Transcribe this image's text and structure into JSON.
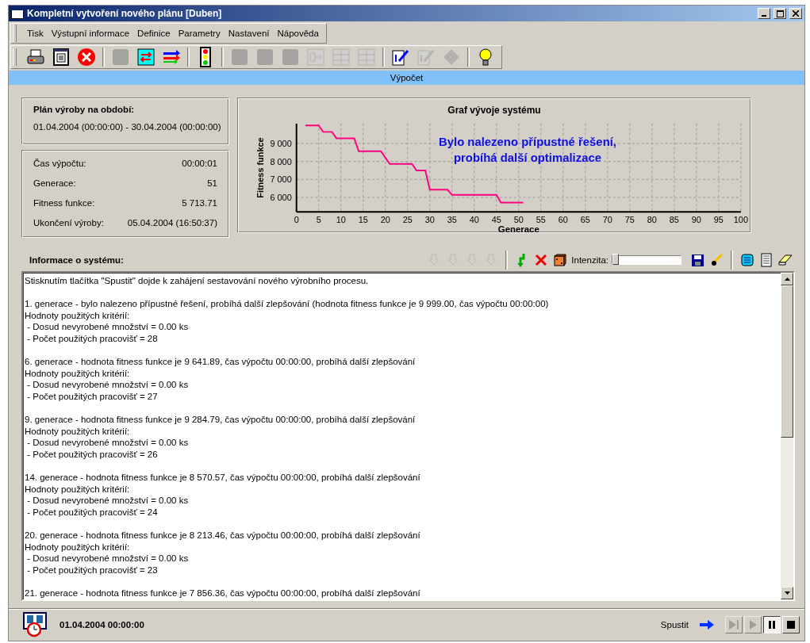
{
  "window": {
    "title": "Kompletní vytvoření nového plánu [Duben]"
  },
  "menu": [
    {
      "label": "Tisk"
    },
    {
      "label": "Výstupní informace"
    },
    {
      "label": "Definice"
    },
    {
      "label": "Parametry"
    },
    {
      "label": "Nastavení"
    },
    {
      "label": "Nápověda"
    }
  ],
  "toolbar": [
    [
      {
        "kind": "printer",
        "disabled": false
      },
      {
        "kind": "document",
        "disabled": false
      },
      {
        "kind": "cancel",
        "disabled": false
      }
    ],
    [
      {
        "kind": "blank",
        "disabled": true
      },
      {
        "kind": "swap",
        "disabled": false
      },
      {
        "kind": "arrows",
        "disabled": false
      }
    ],
    [
      {
        "kind": "traffic",
        "disabled": false
      }
    ],
    [
      {
        "kind": "blank",
        "disabled": true
      },
      {
        "kind": "blank",
        "disabled": true
      },
      {
        "kind": "blank",
        "disabled": true
      },
      {
        "kind": "flow",
        "disabled": true
      },
      {
        "kind": "grid",
        "disabled": true
      },
      {
        "kind": "grid",
        "disabled": true
      }
    ],
    [
      {
        "kind": "edit",
        "disabled": false
      },
      {
        "kind": "edit",
        "disabled": true
      },
      {
        "kind": "diamond",
        "disabled": true
      }
    ],
    [
      {
        "kind": "bulb",
        "disabled": false
      }
    ]
  ],
  "section_bar": "Výpočet",
  "plan": {
    "heading": "Plán výroby na období:",
    "range": "01.04.2004 (00:00:00) - 30.04.2004 (00:00:00)"
  },
  "stats": [
    {
      "label": "Čas výpočtu:",
      "value": "00:00:01"
    },
    {
      "label": "Generace:",
      "value": "51"
    },
    {
      "label": "Fitness funkce:",
      "value": "5 713.71"
    },
    {
      "label": "Ukončení výroby:",
      "value": "05.04.2004 (16:50:37)"
    }
  ],
  "chart": {
    "message": [
      "Bylo nalezeno přípustné řešení,",
      "probíhá další optimalizace"
    ],
    "chart_data": {
      "type": "line",
      "title": "Graf vývoje systému",
      "xlabel": "Generace",
      "ylabel": "Fitness funkce",
      "grid": true,
      "x": [
        2,
        3,
        4,
        5,
        6,
        7,
        8,
        9,
        10,
        11,
        12,
        13,
        14,
        15,
        16,
        17,
        18,
        19,
        20,
        21,
        22,
        23,
        24,
        25,
        26,
        27,
        28,
        29,
        30,
        31,
        32,
        33,
        34,
        35,
        36,
        37,
        38,
        39,
        40,
        41,
        42,
        43,
        44,
        45,
        46,
        47,
        48,
        49,
        50,
        51
      ],
      "series": [
        {
          "color": "#ff0080",
          "values": [
            10000,
            10000,
            10000,
            10000,
            9640,
            9640,
            9640,
            9280,
            9280,
            9280,
            9280,
            9280,
            8570,
            8570,
            8570,
            8570,
            8570,
            8570,
            8210,
            7860,
            7860,
            7860,
            7860,
            7860,
            7860,
            7500,
            7500,
            7500,
            6430,
            6430,
            6430,
            6430,
            6430,
            6140,
            6140,
            6140,
            6140,
            6140,
            6140,
            6140,
            6140,
            6140,
            6140,
            6140,
            5710,
            5710,
            5710,
            5710,
            5710,
            5710
          ]
        }
      ],
      "xlim": [
        0,
        100
      ],
      "ylim": [
        5200,
        10100
      ],
      "xticks": [
        0,
        5,
        10,
        15,
        20,
        25,
        30,
        35,
        40,
        45,
        50,
        55,
        60,
        65,
        70,
        75,
        80,
        85,
        90,
        95,
        100
      ],
      "yticks": [
        {
          "value": 6000,
          "label": "6 000"
        },
        {
          "value": 7000,
          "label": "7 000"
        },
        {
          "value": 8000,
          "label": "8 000"
        },
        {
          "value": 9000,
          "label": "9 000"
        }
      ]
    }
  },
  "log": {
    "heading": "Informace o systému:",
    "tools": [
      [
        {
          "kind": "down",
          "disabled": true
        },
        {
          "kind": "down",
          "disabled": true
        },
        {
          "kind": "down",
          "disabled": true
        },
        {
          "kind": "down",
          "disabled": true
        }
      ],
      [
        {
          "kind": "green-arrow",
          "disabled": false
        },
        {
          "kind": "red-x",
          "disabled": false
        },
        {
          "kind": "dice",
          "disabled": false
        }
      ]
    ],
    "intensity": {
      "label": "Intenzita:",
      "level": 0.02
    },
    "tools2": [
      [
        {
          "kind": "save",
          "disabled": false
        },
        {
          "kind": "brush",
          "disabled": false
        }
      ],
      [
        {
          "kind": "note",
          "disabled": false
        },
        {
          "kind": "list",
          "disabled": false
        },
        {
          "kind": "eraser",
          "disabled": false
        }
      ]
    ],
    "entries": [
      {
        "lines": [
          "Stisknutím tlačítka \"Spustit\" dojde k zahájení sestavování nového výrobního procesu."
        ]
      },
      {
        "lines": [
          "1. generace - bylo nalezeno přípustné řešení, probíhá další zlepšování (hodnota fitness funkce je 9 999.00, čas výpočtu 00:00:00)",
          "Hodnoty použitých kritérií:",
          " - Dosud nevyrobené množství = 0.00 ks",
          " - Počet použitých pracovišť = 28"
        ]
      },
      {
        "lines": [
          "6. generace - hodnota fitness funkce je 9 641.89, čas výpočtu 00:00:00, probíhá další zlepšování",
          "Hodnoty použitých kritérií:",
          " - Dosud nevyrobené množství = 0.00 ks",
          " - Počet použitých pracovišť = 27"
        ]
      },
      {
        "lines": [
          "9. generace - hodnota fitness funkce je 9 284.79, čas výpočtu 00:00:00, probíhá další zlepšování",
          "Hodnoty použitých kritérií:",
          " - Dosud nevyrobené množství = 0.00 ks",
          " - Počet použitých pracovišť = 26"
        ]
      },
      {
        "lines": [
          "14. generace - hodnota fitness funkce je 8 570.57, čas výpočtu 00:00:00, probíhá další zlepšování",
          "Hodnoty použitých kritérií:",
          " - Dosud nevyrobené množství = 0.00 ks",
          " - Počet použitých pracovišť = 24"
        ]
      },
      {
        "lines": [
          "20. generace - hodnota fitness funkce je 8 213.46, čas výpočtu 00:00:00, probíhá další zlepšování",
          "Hodnoty použitých kritérií:",
          " - Dosud nevyrobené množství = 0.00 ks",
          " - Počet použitých pracovišť = 23"
        ]
      },
      {
        "lines": [
          "21. generace - hodnota fitness funkce je 7 856.36, čas výpočtu 00:00:00, probíhá další zlepšování"
        ]
      }
    ]
  },
  "status": {
    "datetime": "01.04.2004 00:00:00",
    "run_label": "Spustit",
    "playback": [
      {
        "kind": "step",
        "disabled": true,
        "pressed": false
      },
      {
        "kind": "play",
        "disabled": true,
        "pressed": false
      },
      {
        "kind": "pause",
        "disabled": false,
        "pressed": true
      },
      {
        "kind": "stop",
        "disabled": false,
        "pressed": false
      }
    ]
  }
}
